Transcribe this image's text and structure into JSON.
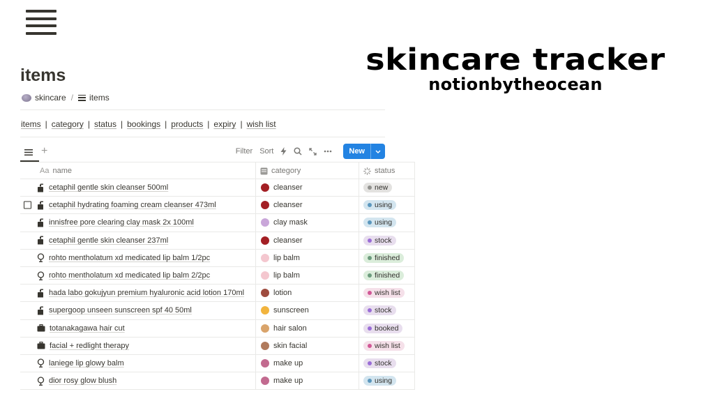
{
  "banner": {
    "title": "skincare tracker",
    "subtitle": "notionbytheocean"
  },
  "page": {
    "title": "items"
  },
  "breadcrumb": [
    {
      "label": "skincare",
      "icon": "stone-icon"
    },
    {
      "label": "items",
      "icon": "list-icon"
    }
  ],
  "breadcrumb_sep": "/",
  "navlinks": [
    "items",
    "category",
    "status",
    "bookings",
    "products",
    "expiry",
    "wish list"
  ],
  "navlink_sep": "|",
  "toolbar": {
    "add_view": "+",
    "filter": "Filter",
    "sort": "Sort",
    "new": "New"
  },
  "table": {
    "headers": {
      "name": "name",
      "name_prefix": "Aa",
      "category": "category",
      "status": "status"
    },
    "rows": [
      {
        "name": "cetaphil gentle skin cleanser 500ml",
        "icon": "bottle-icon",
        "category": "cleanser",
        "cat_color": "#a31f24",
        "status": "new",
        "status_bg": "#e3e2e0",
        "dot": "#91918e",
        "checkbox": false
      },
      {
        "name": "cetaphil hydrating foaming cream cleanser 473ml",
        "icon": "bottle-icon",
        "category": "cleanser",
        "cat_color": "#a31f24",
        "status": "using",
        "status_bg": "#d3e5ef",
        "dot": "#5b97bd",
        "checkbox": true
      },
      {
        "name": "innisfree pore clearing clay mask 2x 100ml",
        "icon": "bottle-icon",
        "category": "clay mask",
        "cat_color": "#c9a6d9",
        "status": "using",
        "status_bg": "#d3e5ef",
        "dot": "#5b97bd",
        "checkbox": false
      },
      {
        "name": "cetaphil gentle skin cleanser 237ml",
        "icon": "bottle-icon",
        "category": "cleanser",
        "cat_color": "#a31f24",
        "status": "stock",
        "status_bg": "#e8deee",
        "dot": "#9a6dd7",
        "checkbox": false
      },
      {
        "name": "rohto mentholatum xd medicated lip balm 1/2pc",
        "icon": "lipstick-icon",
        "category": "lip balm",
        "cat_color": "#f4c7cf",
        "status": "finished",
        "status_bg": "#dbeddb",
        "dot": "#6c9b7d",
        "checkbox": false
      },
      {
        "name": "rohto mentholatum xd medicated lip balm 2/2pc",
        "icon": "lipstick-icon",
        "category": "lip balm",
        "cat_color": "#f4c7cf",
        "status": "finished",
        "status_bg": "#dbeddb",
        "dot": "#6c9b7d",
        "checkbox": false
      },
      {
        "name": "hada labo gokujyun premium hyaluronic acid lotion 170ml",
        "icon": "bottle-icon",
        "category": "lotion",
        "cat_color": "#9e4b3e",
        "status": "wish list",
        "status_bg": "#f5e0e9",
        "dot": "#d15796",
        "checkbox": false
      },
      {
        "name": "supergoop unseen sunscreen spf 40 50ml",
        "icon": "bottle-icon",
        "category": "sunscreen",
        "cat_color": "#f2b43d",
        "status": "stock",
        "status_bg": "#e8deee",
        "dot": "#9a6dd7",
        "checkbox": false
      },
      {
        "name": "totanakagawa hair cut",
        "icon": "briefcase-icon",
        "category": "hair salon",
        "cat_color": "#d9a46b",
        "status": "booked",
        "status_bg": "#e8deee",
        "dot": "#9a6dd7",
        "checkbox": false
      },
      {
        "name": "facial + redlight therapy",
        "icon": "briefcase-icon",
        "category": "skin facial",
        "cat_color": "#b07a5c",
        "status": "wish list",
        "status_bg": "#f5e0e9",
        "dot": "#d15796",
        "checkbox": false
      },
      {
        "name": "laniege lip glowy balm",
        "icon": "lipstick-icon",
        "category": "make up",
        "cat_color": "#c26a8f",
        "status": "stock",
        "status_bg": "#e8deee",
        "dot": "#9a6dd7",
        "checkbox": false
      },
      {
        "name": "dior rosy glow blush",
        "icon": "lipstick-icon",
        "category": "make up",
        "cat_color": "#c26a8f",
        "status": "using",
        "status_bg": "#d3e5ef",
        "dot": "#5b97bd",
        "checkbox": false
      }
    ]
  }
}
